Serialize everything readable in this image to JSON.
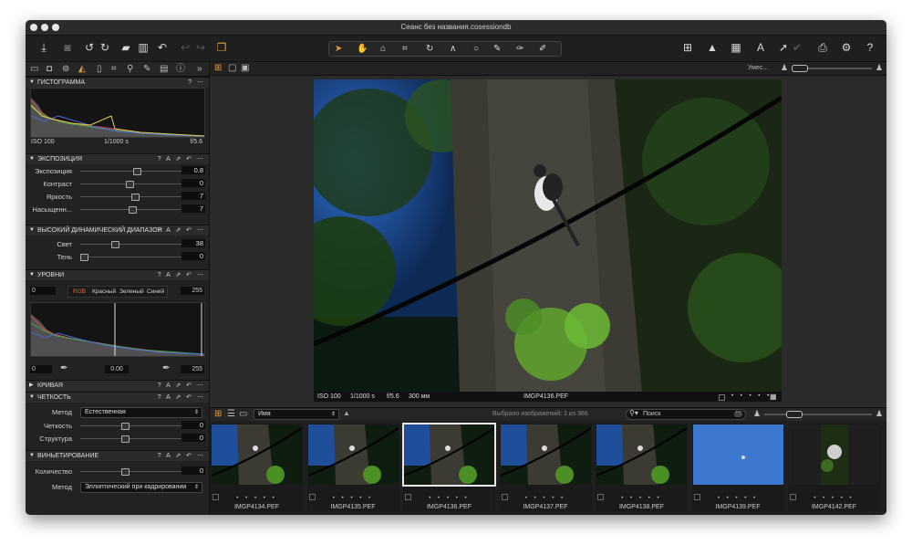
{
  "window": {
    "title": "Сеанс без названия.cosessiondb"
  },
  "toolbar": {
    "icons": [
      "import-icon",
      "camera-icon",
      "rotate-left-icon",
      "rotate-right-icon",
      "folder-icon",
      "trash-icon",
      "reset-icon",
      "undo-icon",
      "redo-icon",
      "copy-icon"
    ],
    "right_icons": [
      "grid-icon",
      "warning-icon",
      "focus-icon",
      "text-icon",
      "arrow-icon",
      "print-icon",
      "gear-icon",
      "help-icon"
    ],
    "help": "?"
  },
  "panel": {
    "histogram": {
      "title": "ГИСТОГРАММА",
      "iso": "ISO 100",
      "shutter": "1/1000 s",
      "aperture": "f/5.6"
    },
    "exposure": {
      "title": "ЭКСПОЗИЦИЯ",
      "rows": [
        {
          "label": "Экспозиция",
          "value": "0.8",
          "pos": 0.52
        },
        {
          "label": "Контраст",
          "value": "0",
          "pos": 0.45
        },
        {
          "label": "Яркость",
          "value": "7",
          "pos": 0.5
        },
        {
          "label": "Насыщенн...",
          "value": "7",
          "pos": 0.47
        }
      ]
    },
    "hdr": {
      "title": "ВЫСОКИЙ ДИНАМИЧЕСКИЙ ДИАПАЗОН",
      "rows": [
        {
          "label": "Свет",
          "value": "38",
          "pos": 0.3
        },
        {
          "label": "Тень",
          "value": "0",
          "pos": 0.0
        }
      ]
    },
    "levels": {
      "title": "УРОВНИ",
      "low": "0",
      "high": "255",
      "mid": "0.00",
      "out_low": "0",
      "out_high": "255",
      "channels": [
        "RGB",
        "Красный",
        "Зеленый",
        "Синий"
      ]
    },
    "curve": {
      "title": "КРИВАЯ"
    },
    "clarity": {
      "title": "ЧЕТКОСТЬ",
      "method_label": "Метод",
      "method_value": "Естественная",
      "rows": [
        {
          "label": "Четкость",
          "value": "0",
          "pos": 0.4
        },
        {
          "label": "Структура",
          "value": "0",
          "pos": 0.4
        }
      ]
    },
    "vignetting": {
      "title": "ВИНЬЕТИРОВАНИЕ",
      "rows": [
        {
          "label": "Количество",
          "value": "0",
          "pos": 0.4
        }
      ],
      "method_label": "Метод",
      "method_value": "Эллиптический при кадрировании"
    }
  },
  "viewer": {
    "fit_label": "Умес...",
    "info": {
      "iso": "ISO 100",
      "shutter": "1/1000 s",
      "aperture": "f/5.6",
      "focal": "300 мм",
      "filename": "IMGP4136.PEF"
    }
  },
  "browser": {
    "sort": "Имя",
    "selected": "Выбрано изображений: 1 из 366",
    "search_placeholder": "Поиск",
    "thumbs": [
      {
        "name": "IMGP4134.PEF",
        "kind": "tree"
      },
      {
        "name": "IMGP4135.PEF",
        "kind": "tree"
      },
      {
        "name": "IMGP4136.PEF",
        "kind": "tree",
        "selected": true
      },
      {
        "name": "IMGP4137.PEF",
        "kind": "tree"
      },
      {
        "name": "IMGP4138.PEF",
        "kind": "tree"
      },
      {
        "name": "IMGP4139.PEF",
        "kind": "sky"
      },
      {
        "name": "IMGP4142.PEF",
        "kind": "portrait"
      }
    ]
  }
}
